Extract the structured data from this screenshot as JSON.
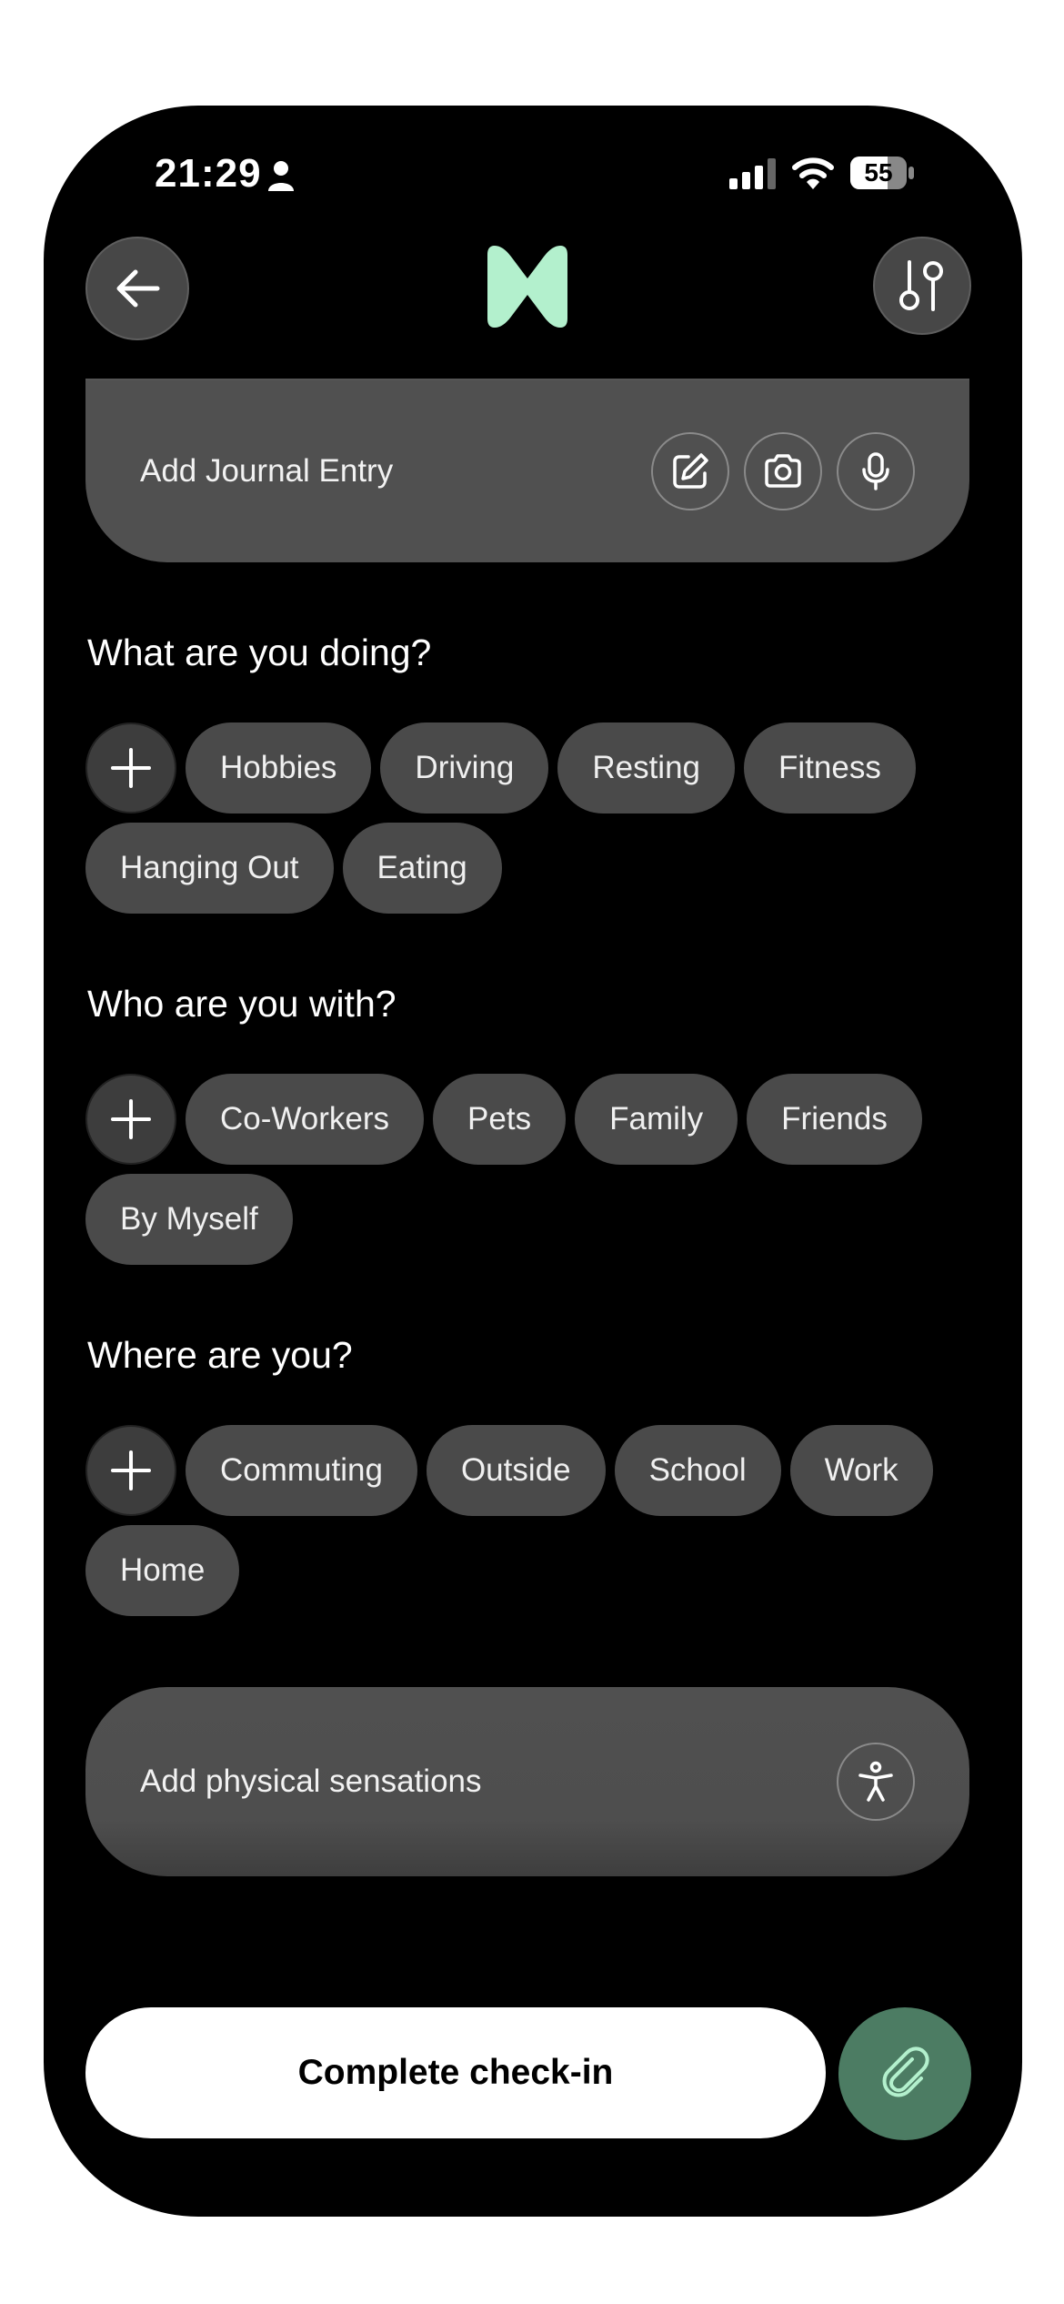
{
  "status_bar": {
    "time": "21:29",
    "battery": "55",
    "icons": [
      "person-icon",
      "signal-icon",
      "wifi-icon",
      "battery-icon"
    ]
  },
  "header": {
    "back_icon": "arrow-left-icon",
    "logo_icon": "app-logo-icon",
    "filter_icon": "sliders-icon",
    "logo_color": "#b3f0cd"
  },
  "journal": {
    "label": "Add Journal Entry",
    "icons": [
      "edit-icon",
      "camera-icon",
      "microphone-icon"
    ]
  },
  "activity": {
    "title": "What are you doing?",
    "chips": [
      "Hobbies",
      "Driving",
      "Resting",
      "Fitness",
      "Hanging Out",
      "Eating"
    ]
  },
  "company": {
    "title": "Who are you with?",
    "chips": [
      "Co-Workers",
      "Pets",
      "Family",
      "Friends",
      "By Myself"
    ]
  },
  "location": {
    "title": "Where are you?",
    "chips": [
      "Commuting",
      "Outside",
      "School",
      "Work",
      "Home"
    ]
  },
  "sensations": {
    "label": "Add physical sensations",
    "icon": "body-icon"
  },
  "footer": {
    "complete_label": "Complete check-in",
    "attach_icon": "paperclip-icon",
    "attach_color": "#4c7c63"
  }
}
